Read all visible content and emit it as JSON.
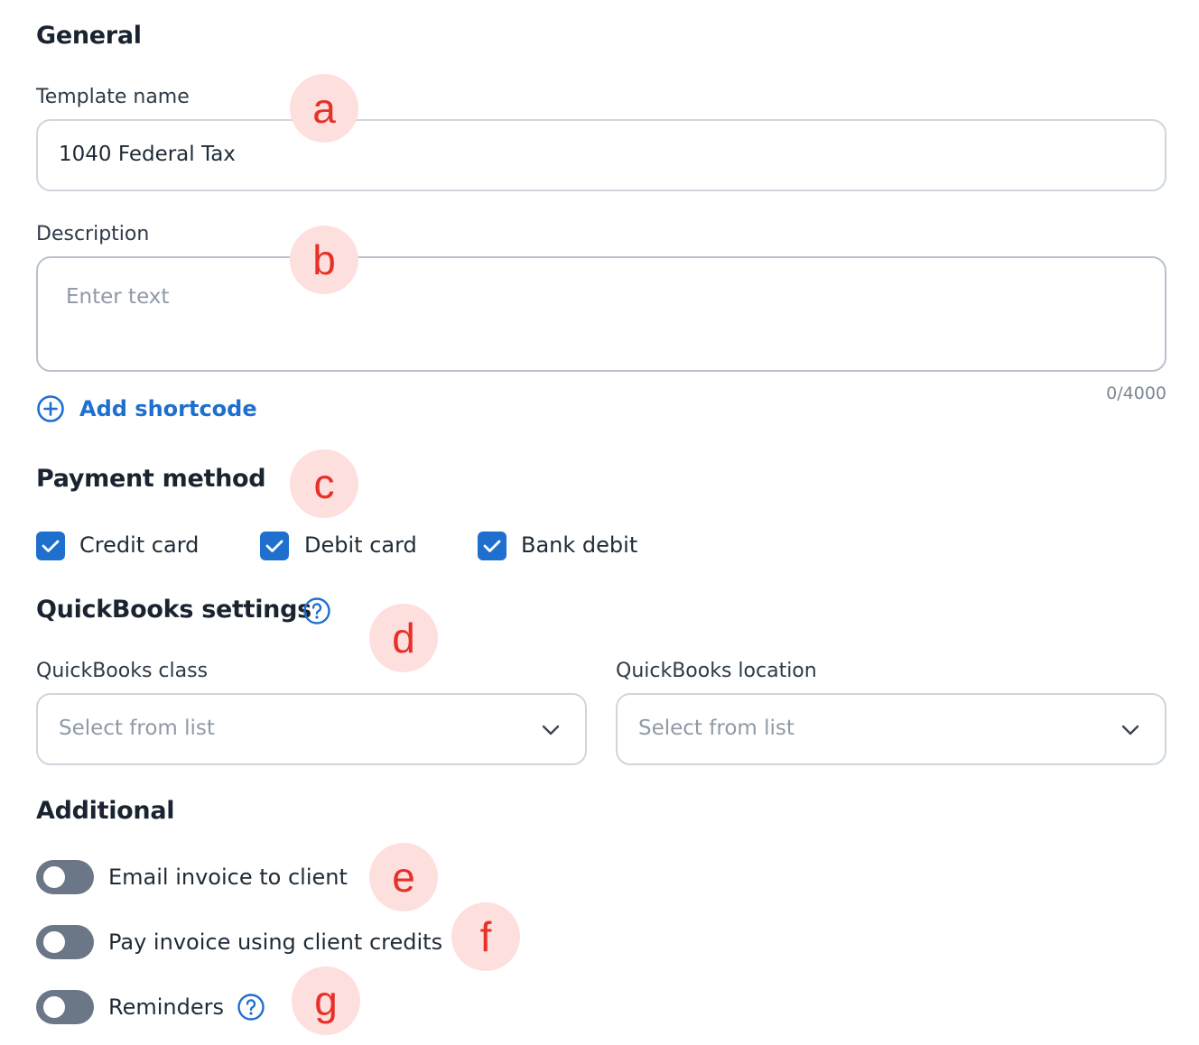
{
  "general": {
    "heading": "General",
    "template_name": {
      "label": "Template name",
      "value": "1040 Federal Tax"
    },
    "description": {
      "label": "Description",
      "placeholder": "Enter text",
      "counter": "0/4000"
    },
    "add_shortcode": {
      "label": "Add shortcode",
      "icon": "plus-circle-icon"
    }
  },
  "payment_method": {
    "heading": "Payment method",
    "options": [
      {
        "label": "Credit card",
        "checked": true
      },
      {
        "label": "Debit card",
        "checked": true
      },
      {
        "label": "Bank debit",
        "checked": true
      }
    ]
  },
  "quickbooks": {
    "heading": "QuickBooks settings",
    "help_icon": "question-circle-icon",
    "class": {
      "label": "QuickBooks class",
      "placeholder": "Select from list"
    },
    "location": {
      "label": "QuickBooks location",
      "placeholder": "Select from list"
    }
  },
  "additional": {
    "heading": "Additional",
    "toggles": [
      {
        "label": "Email invoice to client",
        "on": false
      },
      {
        "label": "Pay invoice using client credits",
        "on": false
      },
      {
        "label": "Reminders",
        "on": false,
        "help_icon": "question-circle-icon"
      }
    ]
  },
  "callouts": [
    "a",
    "b",
    "c",
    "d",
    "e",
    "f",
    "g"
  ],
  "colors": {
    "accent": "#1f6fcf",
    "toggle_off": "#6b7686",
    "callout_bg": "#fde0de",
    "callout_text": "#e8302a",
    "border": "#cfd6de"
  }
}
